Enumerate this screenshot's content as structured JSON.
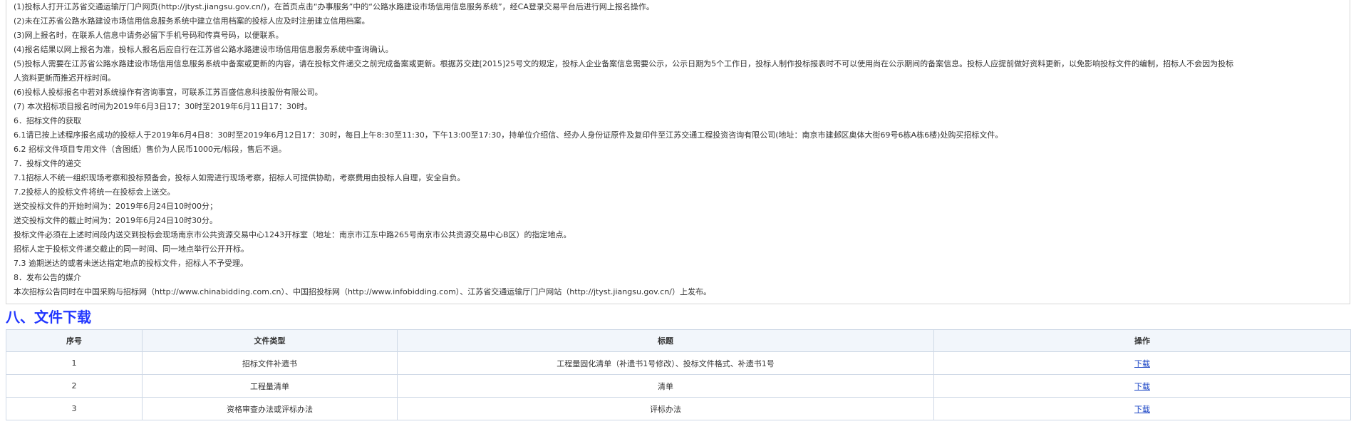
{
  "notice_lines": [
    "(1)投标人打开江苏省交通运输厅门户网页(http://jtyst.jiangsu.gov.cn/)，在首页点击“办事服务”中的“公路水路建设市场信用信息服务系统”，经CA登录交易平台后进行网上报名操作。",
    "(2)未在江苏省公路水路建设市场信用信息服务系统中建立信用档案的投标人应及时注册建立信用档案。",
    "(3)网上报名时，在联系人信息中请务必留下手机号码和传真号码，以便联系。",
    "(4)报名结果以网上报名为准，投标人报名后应自行在江苏省公路水路建设市场信用信息服务系统中查询确认。",
    "(5)投标人需要在江苏省公路水路建设市场信用信息服务系统中备案或更新的内容，请在投标文件递交之前完成备案或更新。根据苏交建[2015]25号文的规定，投标人企业备案信息需要公示，公示日期为5个工作日，投标人制作投标报表时不可以使用尚在公示期间的备案信息。投标人应提前做好资料更新，以免影响投标文件的编制，招标人不会因为投标",
    "人资料更新而推迟开标时间。",
    "(6)投标人投标报名中若对系统操作有咨询事宜，可联系江苏百盛信息科技股份有限公司。",
    "(7) 本次招标项目报名时间为2019年6月3日17：30时至2019年6月11日17：30时。",
    "6．招标文件的获取",
    "6.1请已按上述程序报名成功的投标人于2019年6月4日8：30时至2019年6月12日17：30时，每日上午8:30至11:30，下午13:00至17:30，持单位介绍信、经办人身份证原件及复印件至江苏交通工程投资咨询有限公司(地址：南京市建邺区奥体大街69号6栋A栋6楼)处购买招标文件。",
    "6.2 招标文件项目专用文件（含图纸）售价为人民币1000元/标段，售后不退。",
    "7．投标文件的递交",
    "7.1招标人不统一组织现场考察和投标预备会，投标人如需进行现场考察，招标人可提供协助，考察费用由投标人自理，安全自负。",
    "7.2投标人的投标文件将统一在投标会上送交。",
    "送交投标文件的开始时间为：2019年6月24日10时00分；",
    "送交投标文件的截止时间为：2019年6月24日10时30分。",
    "投标文件必须在上述时间段内送交到投标会现场南京市公共资源交易中心1243开标室（地址：南京市江东中路265号南京市公共资源交易中心B区）的指定地点。",
    "招标人定于投标文件递交截止的同一时间、同一地点举行公开开标。",
    "7.3 逾期送达的或者未送达指定地点的投标文件，招标人不予受理。",
    "8．发布公告的媒介",
    "本次招标公告同时在中国采购与招标网（http://www.chinabidding.com.cn）、中国招投标网（http://www.infobidding.com）、江苏省交通运输厅门户网站（http://jtyst.jiangsu.gov.cn/）上发布。"
  ],
  "section_title": "八、文件下载",
  "table": {
    "headers": [
      "序号",
      "文件类型",
      "标题",
      "操作"
    ],
    "rows": [
      {
        "no": "1",
        "type": "招标文件补遗书",
        "title": "工程量固化清单（补遗书1号修改）、投标文件格式、补遗书1号",
        "action": "下载"
      },
      {
        "no": "2",
        "type": "工程量清单",
        "title": "清单",
        "action": "下载"
      },
      {
        "no": "3",
        "type": "资格审查办法或评标办法",
        "title": "评标办法",
        "action": "下载"
      }
    ]
  },
  "colors": {
    "section_title": "#2136ff",
    "link": "#1a44c5",
    "border": "#cfd9e6"
  }
}
